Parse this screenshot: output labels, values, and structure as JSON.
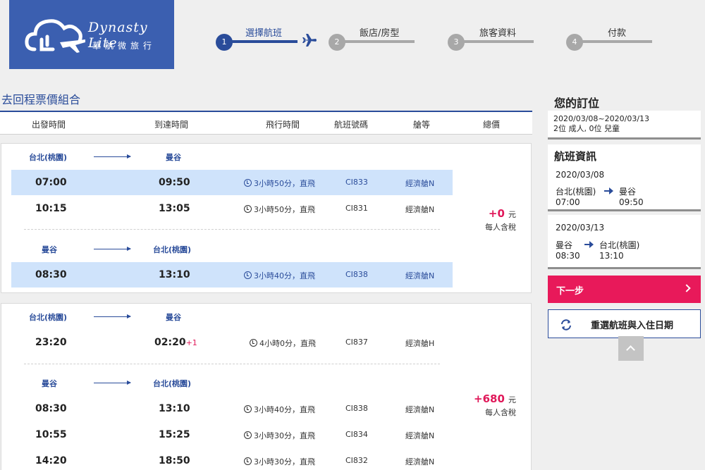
{
  "logo": {
    "brand_en": "Dynasty Lite",
    "brand_zh": "華航微旅行"
  },
  "steps": [
    {
      "num": "1",
      "label": "選擇航班",
      "active": true
    },
    {
      "num": "2",
      "label": "飯店/房型",
      "active": false
    },
    {
      "num": "3",
      "label": "旅客資料",
      "active": false
    },
    {
      "num": "4",
      "label": "付款",
      "active": false
    }
  ],
  "section_title": "去回程票價組合",
  "columns": [
    "出發時間",
    "到達時間",
    "飛行時間",
    "航班號碼",
    "艙等",
    "總價"
  ],
  "option1": {
    "out_from": "台北(桃園)",
    "out_to": "曼谷",
    "out_flights": [
      {
        "dep": "07:00",
        "arr": "09:50",
        "dur": "3小時50分，直飛",
        "fno": "CI833",
        "cabin": "經濟艙N"
      },
      {
        "dep": "10:15",
        "arr": "13:05",
        "dur": "3小時50分，直飛",
        "fno": "CI831",
        "cabin": "經濟艙N"
      }
    ],
    "ret_from": "曼谷",
    "ret_to": "台北(桃園)",
    "ret_flights": [
      {
        "dep": "08:30",
        "arr": "13:10",
        "dur": "3小時40分，直飛",
        "fno": "CI838",
        "cabin": "經濟艙N"
      }
    ],
    "price": "+0",
    "unit": "元",
    "note": "每人含稅"
  },
  "option2": {
    "out_from": "台北(桃園)",
    "out_to": "曼谷",
    "out_flights": [
      {
        "dep": "23:20",
        "arr": "02:20",
        "arr_sup": "+1",
        "dur": "4小時0分，直飛",
        "fno": "CI837",
        "cabin": "經濟艙H"
      }
    ],
    "ret_from": "曼谷",
    "ret_to": "台北(桃園)",
    "ret_flights": [
      {
        "dep": "08:30",
        "arr": "13:10",
        "dur": "3小時40分，直飛",
        "fno": "CI838",
        "cabin": "經濟艙N"
      },
      {
        "dep": "10:55",
        "arr": "15:25",
        "dur": "3小時30分，直飛",
        "fno": "CI834",
        "cabin": "經濟艙N"
      },
      {
        "dep": "14:20",
        "arr": "18:50",
        "dur": "3小時30分，直飛",
        "fno": "CI832",
        "cabin": "經濟艙N"
      }
    ],
    "price": "+680",
    "unit": "元",
    "note": "每人含稅"
  },
  "sidebar": {
    "title": "您的訂位",
    "date_range": "2020/03/08~2020/03/13",
    "pax": "2位 成人, 0位 兒童",
    "info_title": "航班資訊",
    "leg1": {
      "date": "2020/03/08",
      "from": "台北(桃園)",
      "to": "曼谷",
      "dep": "07:00",
      "arr": "09:50"
    },
    "leg2": {
      "date": "2020/03/13",
      "from": "曼谷",
      "to": "台北(桃園)",
      "dep": "08:30",
      "arr": "13:10"
    },
    "next_label": "下一步",
    "reset_label": "重選航班與入住日期"
  },
  "colors": {
    "brand_blue": "#2a4c9a",
    "accent_pink": "#e8195a",
    "selected_row": "#cfe3fb"
  }
}
